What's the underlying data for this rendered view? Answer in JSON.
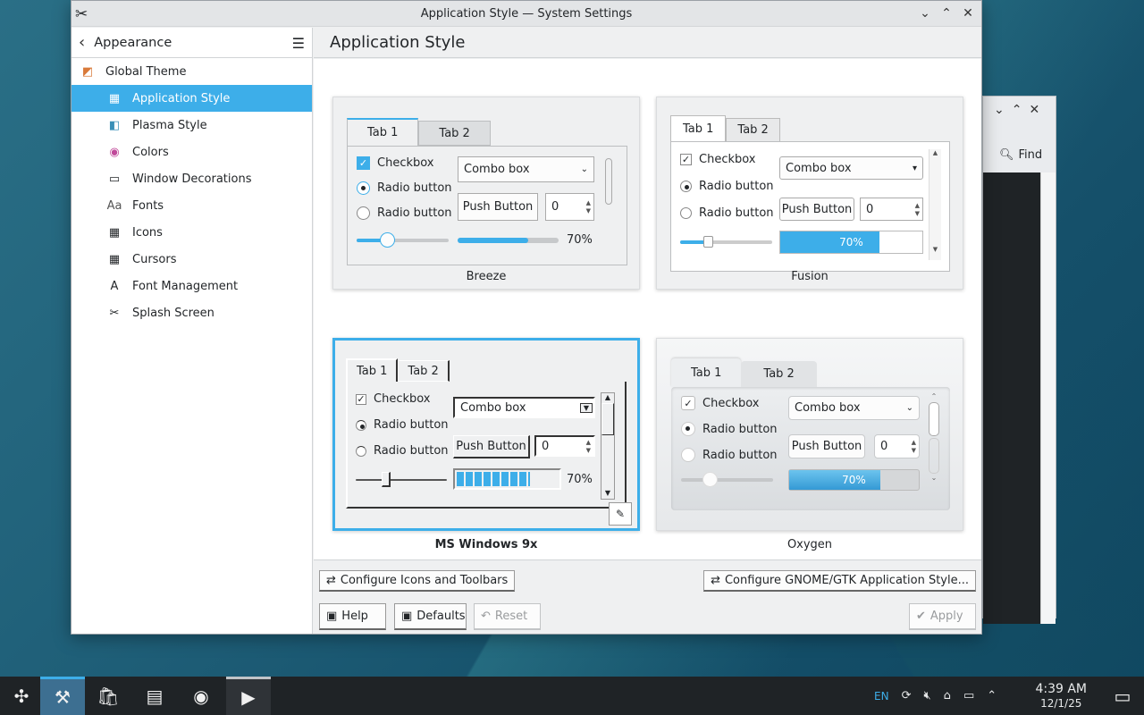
{
  "window": {
    "title": "Application Style — System Settings",
    "min": "⌄",
    "max": "⌃",
    "close": "✕"
  },
  "sidebar": {
    "back_label": "Appearance",
    "items": [
      {
        "label": "Global Theme",
        "icon": "global-theme-icon"
      },
      {
        "label": "Application Style",
        "icon": "application-style-icon",
        "selected": true
      },
      {
        "label": "Plasma Style",
        "icon": "plasma-style-icon"
      },
      {
        "label": "Colors",
        "icon": "colors-icon"
      },
      {
        "label": "Window Decorations",
        "icon": "window-decorations-icon"
      },
      {
        "label": "Fonts",
        "icon": "fonts-icon"
      },
      {
        "label": "Icons",
        "icon": "icons-icon"
      },
      {
        "label": "Cursors",
        "icon": "cursors-icon"
      },
      {
        "label": "Font Management",
        "icon": "font-management-icon"
      },
      {
        "label": "Splash Screen",
        "icon": "splash-screen-icon"
      }
    ]
  },
  "page": {
    "title": "Application Style"
  },
  "preview": {
    "tab1": "Tab 1",
    "tab2": "Tab 2",
    "checkbox": "Checkbox",
    "radio": "Radio button",
    "combo": "Combo box",
    "push": "Push Button",
    "spin": "0",
    "progress": "70%",
    "progress_value": 0.7
  },
  "styles": [
    {
      "name": "Breeze"
    },
    {
      "name": "Fusion"
    },
    {
      "name": "MS Windows 9x",
      "selected": true
    },
    {
      "name": "Oxygen"
    }
  ],
  "buttons": {
    "configure_icons": "Configure Icons and Toolbars",
    "configure_gtk": "Configure GNOME/GTK Application Style...",
    "help": "Help",
    "defaults": "Defaults",
    "reset": "Reset",
    "apply": "Apply"
  },
  "bgwindow": {
    "find": "Find"
  },
  "taskbar": {
    "lang": "EN",
    "time": "4:39 AM",
    "date": "12/1/25"
  }
}
